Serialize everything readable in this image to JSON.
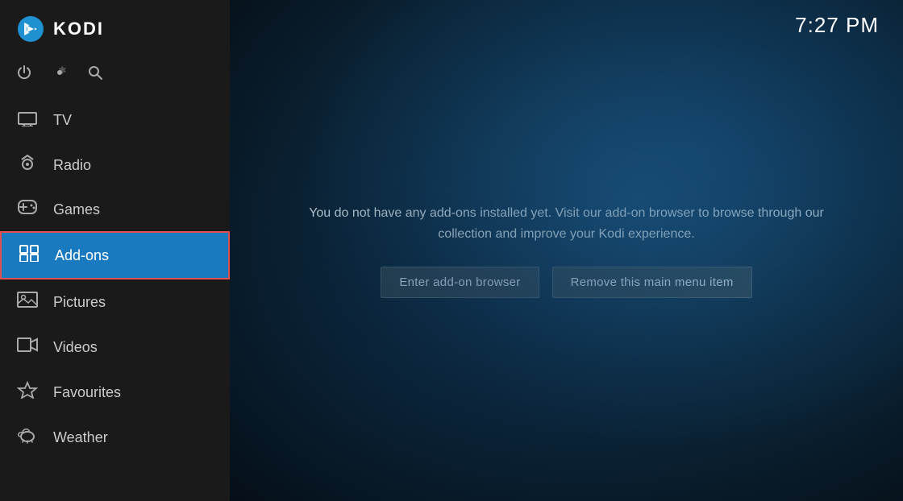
{
  "app": {
    "title": "KODI",
    "clock": "7:27 PM"
  },
  "sidebar": {
    "controls": [
      {
        "id": "power",
        "icon": "⏻",
        "label": "Power"
      },
      {
        "id": "settings",
        "icon": "⚙",
        "label": "Settings"
      },
      {
        "id": "search",
        "icon": "🔍",
        "label": "Search"
      }
    ],
    "nav_items": [
      {
        "id": "tv",
        "label": "TV",
        "icon": "tv"
      },
      {
        "id": "radio",
        "label": "Radio",
        "icon": "radio"
      },
      {
        "id": "games",
        "label": "Games",
        "icon": "games"
      },
      {
        "id": "addons",
        "label": "Add-ons",
        "icon": "addons",
        "active": true
      },
      {
        "id": "pictures",
        "label": "Pictures",
        "icon": "pictures"
      },
      {
        "id": "videos",
        "label": "Videos",
        "icon": "videos"
      },
      {
        "id": "favourites",
        "label": "Favourites",
        "icon": "favourites"
      },
      {
        "id": "weather",
        "label": "Weather",
        "icon": "weather"
      }
    ]
  },
  "main": {
    "info_text": "You do not have any add-ons installed yet. Visit our add-on browser to browse through our collection and improve your Kodi experience.",
    "buttons": [
      {
        "id": "enter-addon-browser",
        "label": "Enter add-on browser"
      },
      {
        "id": "remove-menu-item",
        "label": "Remove this main menu item"
      }
    ]
  }
}
